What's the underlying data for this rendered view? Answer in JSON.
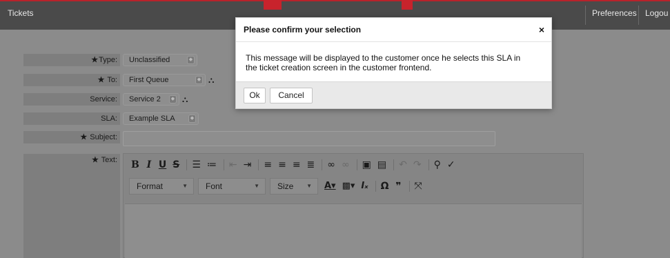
{
  "nav": {
    "tickets": "Tickets",
    "preferences": "Preferences",
    "logout": "Logou"
  },
  "form": {
    "type": {
      "label": "Type:",
      "value": "Unclassified",
      "required": "★"
    },
    "to": {
      "label": "To:",
      "value": "First Queue",
      "required": "★"
    },
    "service": {
      "label": "Service:",
      "value": "Service 2"
    },
    "sla": {
      "label": "SLA:",
      "value": "Example SLA"
    },
    "subject": {
      "label": "Subject:",
      "required": "★",
      "value": ""
    },
    "text": {
      "label": "Text:",
      "required": "★"
    }
  },
  "editor": {
    "format_label": "Format",
    "font_label": "Font",
    "size_label": "Size"
  },
  "dialog": {
    "title": "Please confirm your selection",
    "close_symbol": "×",
    "message_line1": "This message will be displayed to the customer once he selects this SLA in",
    "message_line2": "the ticket creation screen in the customer frontend.",
    "ok_label": "Ok",
    "cancel_label": "Cancel"
  },
  "colors": {
    "brand_red": "#c8232c",
    "overlay_gray": "#8b8b8b",
    "dialog_bg": "#ffffff"
  }
}
